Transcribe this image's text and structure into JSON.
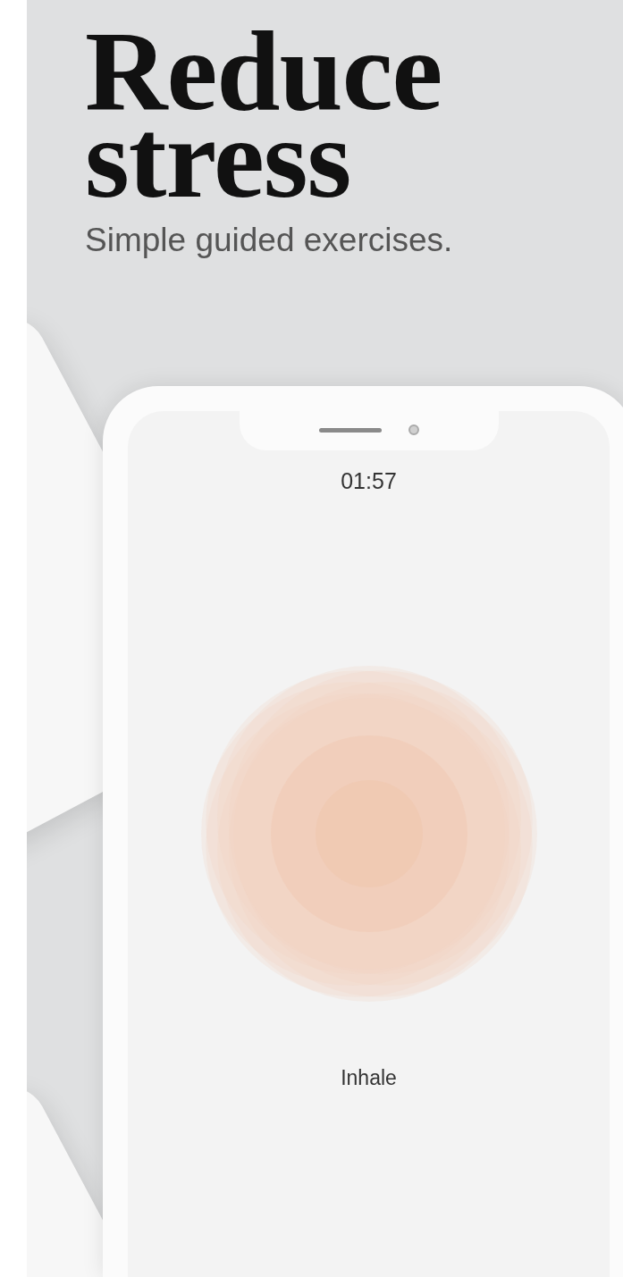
{
  "headline": "Reduce stress",
  "subtitle": "Simple guided exercises.",
  "phone": {
    "timer": "01:57",
    "phase": "Inhale"
  }
}
